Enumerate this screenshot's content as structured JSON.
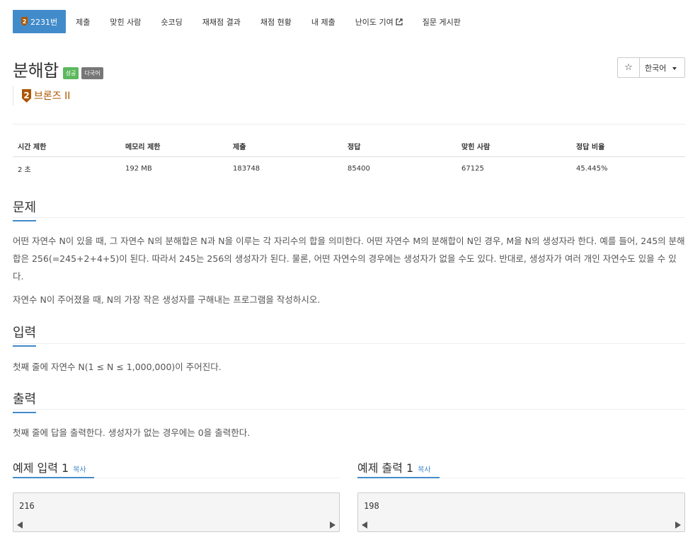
{
  "nav": {
    "items": [
      {
        "label": "2231번",
        "active": true
      },
      {
        "label": "제출"
      },
      {
        "label": "맞힌 사람"
      },
      {
        "label": "숏코딩"
      },
      {
        "label": "재채점 결과"
      },
      {
        "label": "채점 현황"
      },
      {
        "label": "내 제출"
      },
      {
        "label": "난이도 기여"
      },
      {
        "label": "질문 게시판"
      }
    ]
  },
  "problem": {
    "title": "분해합",
    "labels": [
      "성공",
      "다국어"
    ],
    "tier": "브론즈 II",
    "tier_level": "2"
  },
  "toolbar": {
    "star": "☆",
    "language": "한국어"
  },
  "info": {
    "headers": [
      "시간 제한",
      "메모리 제한",
      "제출",
      "정답",
      "맞힌 사람",
      "정답 비율"
    ],
    "values": [
      "2 초",
      "192 MB",
      "183748",
      "85400",
      "67125",
      "45.445%"
    ]
  },
  "sections": {
    "description_title": "문제",
    "description_p1": "어떤 자연수 N이 있을 때, 그 자연수 N의 분해합은 N과 N을 이루는 각 자리수의 합을 의미한다. 어떤 자연수 M의 분해합이 N인 경우, M을 N의 생성자라 한다. 예를 들어, 245의 분해합은 256(=245+2+4+5)이 된다. 따라서 245는 256의 생성자가 된다. 물론, 어떤 자연수의 경우에는 생성자가 없을 수도 있다. 반대로, 생성자가 여러 개인 자연수도 있을 수 있다.",
    "description_p2": "자연수 N이 주어졌을 때, N의 가장 작은 생성자를 구해내는 프로그램을 작성하시오.",
    "input_title": "입력",
    "input_text": "첫째 줄에 자연수 N(1 ≤ N ≤ 1,000,000)이 주어진다.",
    "output_title": "출력",
    "output_text": "첫째 줄에 답을 출력한다. 생성자가 없는 경우에는 0을 출력한다."
  },
  "samples": {
    "input_title": "예제 입력 1",
    "output_title": "예제 출력 1",
    "copy_label": "복사",
    "input_value": "216",
    "output_value": "198"
  },
  "colors": {
    "primary": "#428bca",
    "success": "#5cb85c",
    "default": "#777777",
    "bronze": "#ad5600"
  }
}
